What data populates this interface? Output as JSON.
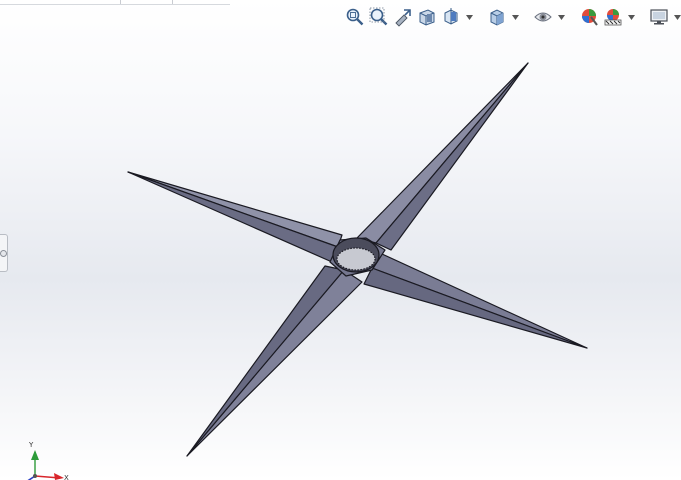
{
  "viewport": {
    "background_top": "#ffffff",
    "background_mid": "#e6e9ef",
    "model_face_color": "#6e7088",
    "model_face_light": "#9a9cb2",
    "model_edge_color": "#1a1a22"
  },
  "heads_up_toolbar": {
    "items": [
      {
        "name": "zoom-to-fit-icon"
      },
      {
        "name": "zoom-to-area-icon"
      },
      {
        "name": "previous-view-icon"
      },
      {
        "name": "section-view-icon"
      },
      {
        "name": "view-orientation-icon",
        "has_dropdown": true
      },
      {
        "name": "display-style-icon",
        "has_dropdown": true
      },
      {
        "name": "hide-show-items-icon",
        "has_dropdown": true
      },
      {
        "name": "edit-appearance-icon"
      },
      {
        "name": "apply-scene-icon",
        "has_dropdown": true
      },
      {
        "name": "view-settings-icon",
        "has_dropdown": true
      }
    ]
  },
  "triad": {
    "y_label": "Y",
    "x_label": "X",
    "y_color": "#2d9b3a",
    "x_color": "#d8262b",
    "z_color": "#2a3fc4"
  }
}
